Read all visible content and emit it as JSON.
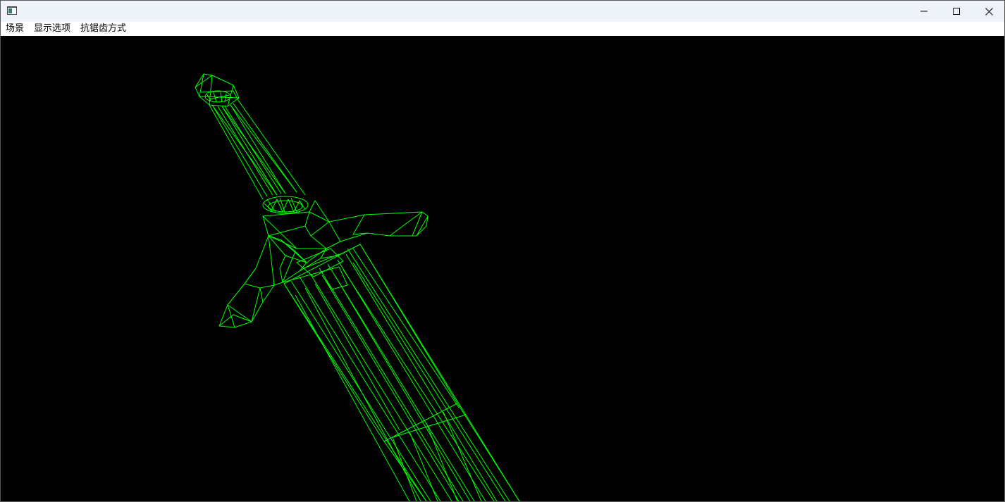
{
  "window": {
    "app_icon": "window-app-icon",
    "controls": {
      "minimize_icon": "minimize-icon",
      "maximize_icon": "maximize-icon",
      "close_icon": "close-icon"
    }
  },
  "menu": {
    "items": [
      {
        "label": "场景"
      },
      {
        "label": "显示选项"
      },
      {
        "label": "抗锯齿方式"
      }
    ]
  },
  "viewport": {
    "background": "#000000",
    "wire_color": "#00ff00",
    "content": "wireframe-sword-model"
  }
}
